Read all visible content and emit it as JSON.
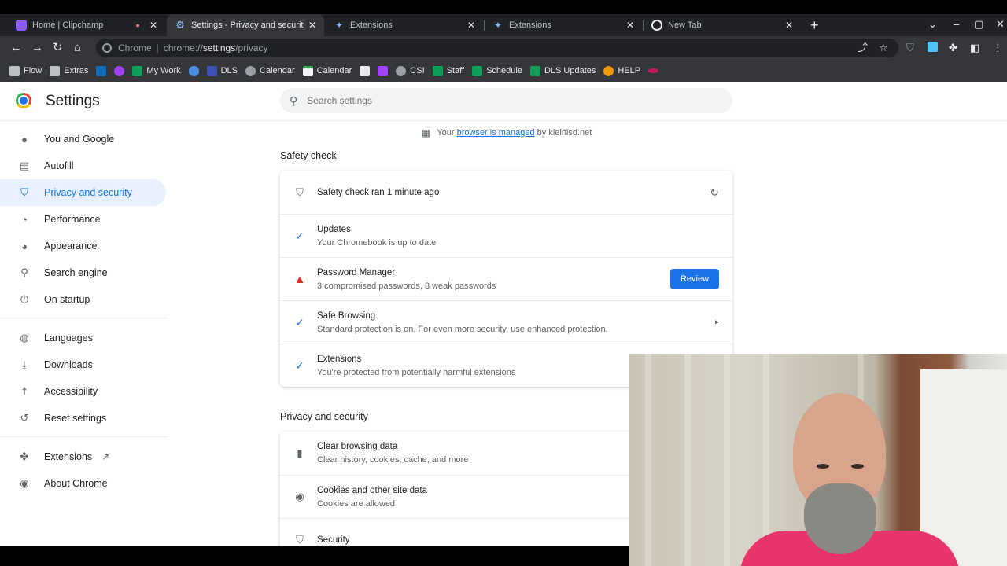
{
  "tabs": [
    {
      "title": "Home | Clipchamp",
      "active": false
    },
    {
      "title": "Settings - Privacy and security",
      "active": true
    },
    {
      "title": "Extensions",
      "active": false
    },
    {
      "title": "Extensions",
      "active": false
    },
    {
      "title": "New Tab",
      "active": false
    }
  ],
  "toolbar": {
    "omnibox_scheme": "Chrome",
    "omnibox_url_prefix": "chrome://",
    "omnibox_url_host": "settings",
    "omnibox_url_path": "/privacy"
  },
  "bookmarks": [
    {
      "label": "Flow",
      "icon": "folder-icon"
    },
    {
      "label": "Extras",
      "icon": "folder-icon"
    },
    {
      "label": "",
      "icon": "outlook-icon"
    },
    {
      "label": "",
      "icon": "app-icon"
    },
    {
      "label": "My Work",
      "icon": "plus-icon"
    },
    {
      "label": "",
      "icon": "onedrive-icon"
    },
    {
      "label": "DLS",
      "icon": "app-icon"
    },
    {
      "label": "Calendar",
      "icon": "globe-icon"
    },
    {
      "label": "Calendar",
      "icon": "calendar-icon"
    },
    {
      "label": "",
      "icon": "app-icon"
    },
    {
      "label": "",
      "icon": "app-icon"
    },
    {
      "label": "CSI",
      "icon": "globe-icon"
    },
    {
      "label": "Staff",
      "icon": "plus-icon"
    },
    {
      "label": "Schedule",
      "icon": "plus-icon"
    },
    {
      "label": "DLS Updates",
      "icon": "plus-icon"
    },
    {
      "label": "HELP",
      "icon": "app-icon"
    },
    {
      "label": "",
      "icon": "app-icon"
    }
  ],
  "settings": {
    "title": "Settings",
    "search_placeholder": "Search settings",
    "managed_prefix": "Your",
    "managed_link": "browser is managed",
    "managed_suffix": "by kleinisd.net"
  },
  "sidebar": {
    "items": [
      {
        "label": "You and Google",
        "icon": "person-icon"
      },
      {
        "label": "Autofill",
        "icon": "clipboard-icon"
      },
      {
        "label": "Privacy and security",
        "icon": "shield-icon"
      },
      {
        "label": "Performance",
        "icon": "gauge-icon"
      },
      {
        "label": "Appearance",
        "icon": "palette-icon"
      },
      {
        "label": "Search engine",
        "icon": "search-icon"
      },
      {
        "label": "On startup",
        "icon": "power-icon"
      },
      {
        "label": "Languages",
        "icon": "globe-icon"
      },
      {
        "label": "Downloads",
        "icon": "download-icon"
      },
      {
        "label": "Accessibility",
        "icon": "accessibility-icon"
      },
      {
        "label": "Reset settings",
        "icon": "history-icon"
      },
      {
        "label": "Extensions",
        "icon": "puzzle-icon"
      },
      {
        "label": "About Chrome",
        "icon": "chrome-icon"
      }
    ]
  },
  "safety_check": {
    "title": "Safety check",
    "header": "Safety check ran 1 minute ago",
    "rows": [
      {
        "title": "Updates",
        "subtitle": "Your Chromebook is up to date"
      },
      {
        "title": "Password Manager",
        "subtitle": "3 compromised passwords, 8 weak passwords",
        "button": "Review"
      },
      {
        "title": "Safe Browsing",
        "subtitle": "Standard protection is on. For even more security, use enhanced protection."
      },
      {
        "title": "Extensions",
        "subtitle": "You're protected from potentially harmful extensions"
      }
    ]
  },
  "privacy": {
    "title": "Privacy and security",
    "rows": [
      {
        "title": "Clear browsing data",
        "subtitle": "Clear history, cookies, cache, and more"
      },
      {
        "title": "Cookies and other site data",
        "subtitle": "Cookies are allowed"
      },
      {
        "title": "Security",
        "subtitle": ""
      }
    ]
  },
  "colors": {
    "accent": "#1a73e8",
    "warning": "#d93025",
    "tabstrip": "#202124",
    "toolbar": "#35363a"
  }
}
